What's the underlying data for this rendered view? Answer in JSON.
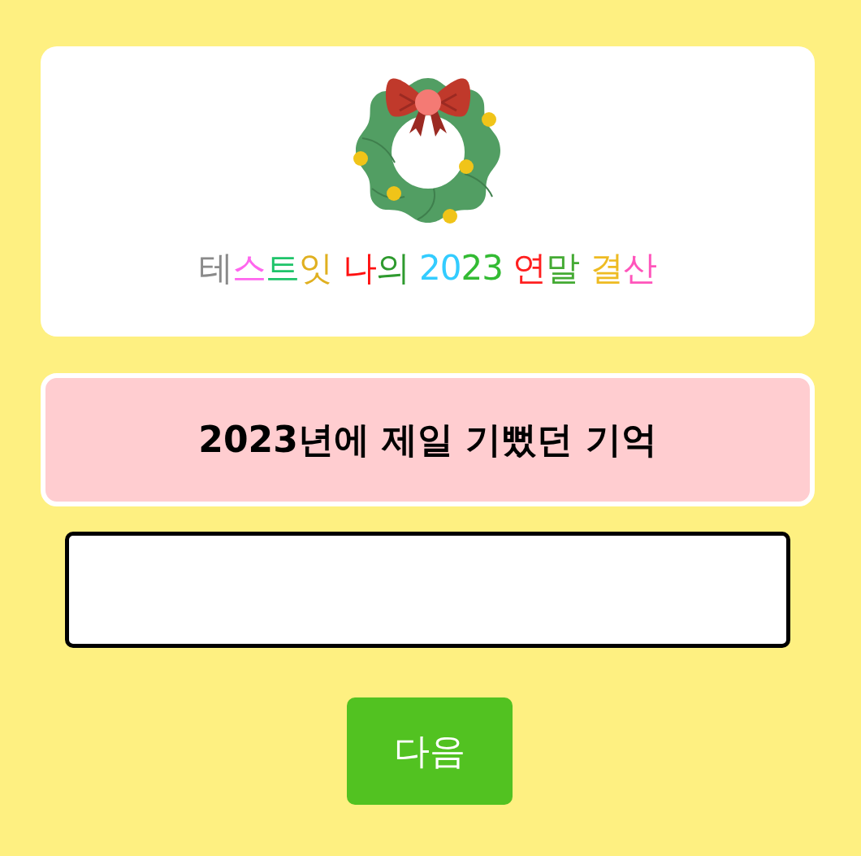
{
  "logo": {
    "words": [
      {
        "parts": [
          {
            "text": "테",
            "color": "#8a8a8a"
          },
          {
            "text": "스",
            "color": "#ff66ee"
          },
          {
            "text": "트",
            "color": "#1fc46a"
          },
          {
            "text": "잇",
            "color": "#e0b020"
          }
        ]
      },
      {
        "parts": [
          {
            "text": "나",
            "color": "#ff1010"
          },
          {
            "text": "의",
            "color": "#2e9a2e"
          }
        ]
      },
      {
        "parts": [
          {
            "text": "20",
            "color": "#33ccff"
          },
          {
            "text": "23",
            "color": "#33bb33"
          }
        ]
      },
      {
        "parts": [
          {
            "text": "연",
            "color": "#ff2020"
          },
          {
            "text": "말",
            "color": "#44aa33"
          }
        ]
      },
      {
        "parts": [
          {
            "text": "결",
            "color": "#eebb22"
          },
          {
            "text": "산",
            "color": "#ff55bb"
          }
        ]
      }
    ]
  },
  "question": {
    "title": "2023년에 제일 기뻤던 기억"
  },
  "next_button": {
    "label": "다음"
  }
}
